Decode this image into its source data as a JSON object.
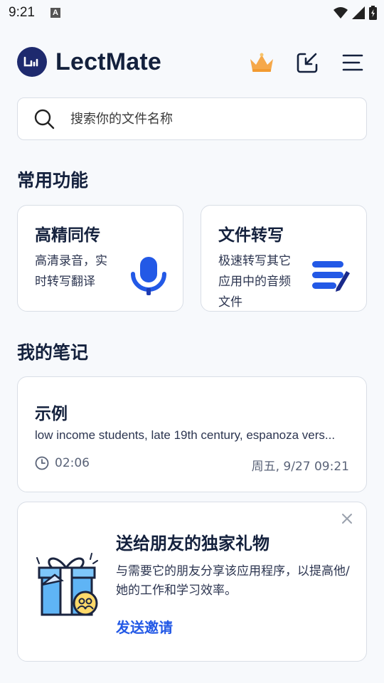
{
  "status_bar": {
    "time": "9:21",
    "notification_badge": "A"
  },
  "header": {
    "app_title": "LectMate"
  },
  "search": {
    "placeholder": "搜索你的文件名称"
  },
  "sections": {
    "common_features": "常用功能",
    "my_notes": "我的笔记"
  },
  "features": [
    {
      "title": "高精同传",
      "desc": "高清录音，实时转写翻译",
      "icon": "microphone-icon"
    },
    {
      "title": "文件转写",
      "desc": "极速转写其它应用中的音频文件",
      "icon": "document-edit-icon"
    }
  ],
  "notes": [
    {
      "title": "示例",
      "preview": "low income students, late 19th century, espanoza vers...",
      "duration": "02:06",
      "date": "周五, 9/27 09:21"
    }
  ],
  "invite": {
    "title": "送给朋友的独家礼物",
    "desc": "与需要它的朋友分享该应用程序，以提高他/她的工作和学习效率。",
    "action": "发送邀请"
  },
  "colors": {
    "accent": "#2359e6",
    "brand_dark": "#1e2a6e",
    "text": "#14213d"
  }
}
